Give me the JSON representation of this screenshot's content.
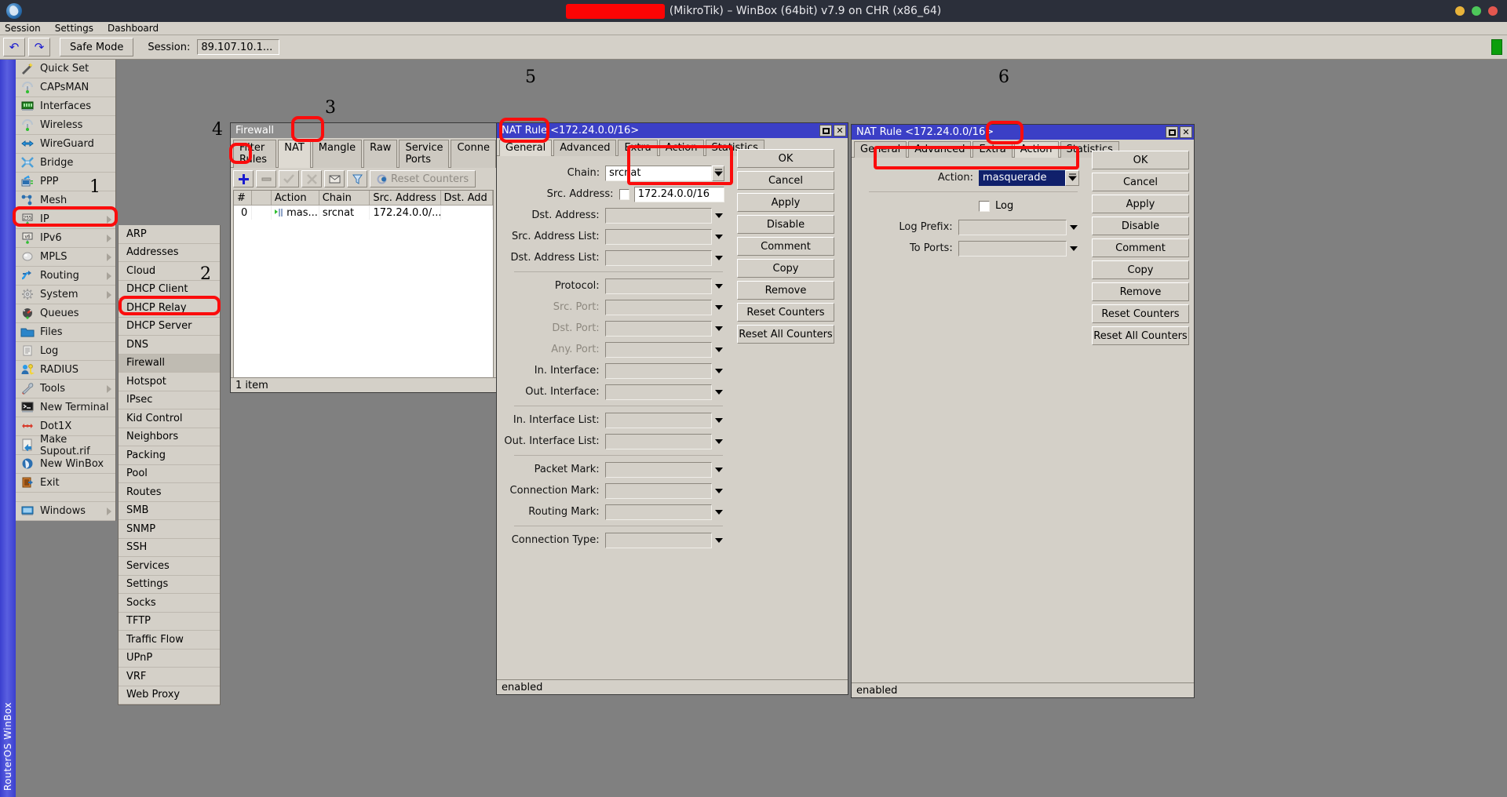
{
  "os": {
    "title_redacted": true,
    "title_suffix": "(MikroTik) – WinBox (64bit) v7.9 on CHR (x86_64)",
    "window_controls": [
      "minimize",
      "maximize",
      "close"
    ]
  },
  "menubar": {
    "items": [
      "Session",
      "Settings",
      "Dashboard"
    ]
  },
  "toolbar": {
    "undo_icon": "undo-icon",
    "redo_icon": "redo-icon",
    "safe_mode_label": "Safe Mode",
    "session_label": "Session:",
    "session_value": "89.107.10.1..."
  },
  "left_strip": {
    "label": "RouterOS WinBox"
  },
  "mainmenu": {
    "items": [
      {
        "label": "Quick Set",
        "icon": "wand-icon",
        "arrow": false
      },
      {
        "label": "CAPsMAN",
        "icon": "antenna-icon",
        "arrow": false
      },
      {
        "label": "Interfaces",
        "icon": "nic-card-icon",
        "arrow": false
      },
      {
        "label": "Wireless",
        "icon": "antenna-icon",
        "arrow": false
      },
      {
        "label": "WireGuard",
        "icon": "arrows-icon",
        "arrow": false
      },
      {
        "label": "Bridge",
        "icon": "bridge-icon",
        "arrow": false
      },
      {
        "label": "PPP",
        "icon": "ppp-icon",
        "arrow": false
      },
      {
        "label": "Mesh",
        "icon": "mesh-icon",
        "arrow": false
      },
      {
        "label": "IP",
        "icon": "ip-255-icon",
        "arrow": true
      },
      {
        "label": "IPv6",
        "icon": "ipv6-icon",
        "arrow": true
      },
      {
        "label": "MPLS",
        "icon": "mpls-icon",
        "arrow": true
      },
      {
        "label": "Routing",
        "icon": "routing-icon",
        "arrow": true
      },
      {
        "label": "System",
        "icon": "gear-icon",
        "arrow": true
      },
      {
        "label": "Queues",
        "icon": "gauge-icon",
        "arrow": false
      },
      {
        "label": "Files",
        "icon": "folder-icon",
        "arrow": false
      },
      {
        "label": "Log",
        "icon": "log-icon",
        "arrow": false
      },
      {
        "label": "RADIUS",
        "icon": "radius-user-key-icon",
        "arrow": false
      },
      {
        "label": "Tools",
        "icon": "tools-icon",
        "arrow": true
      },
      {
        "label": "New Terminal",
        "icon": "terminal-icon",
        "arrow": false
      },
      {
        "label": "Dot1X",
        "icon": "dot1x-icon",
        "arrow": false
      },
      {
        "label": "Make Supout.rif",
        "icon": "supout-icon",
        "arrow": false
      },
      {
        "label": "New WinBox",
        "icon": "winbox-icon",
        "arrow": false
      },
      {
        "label": "Exit",
        "icon": "exit-icon",
        "arrow": false
      }
    ],
    "after_separator": [
      {
        "label": "Windows",
        "icon": "monitor-icon",
        "arrow": true
      }
    ]
  },
  "submenu": {
    "parent": "IP",
    "selected": "Firewall",
    "items": [
      "ARP",
      "Addresses",
      "Cloud",
      "DHCP Client",
      "DHCP Relay",
      "DHCP Server",
      "DNS",
      "Firewall",
      "Hotspot",
      "IPsec",
      "Kid Control",
      "Neighbors",
      "Packing",
      "Pool",
      "Routes",
      "SMB",
      "SNMP",
      "SSH",
      "Services",
      "Settings",
      "Socks",
      "TFTP",
      "Traffic Flow",
      "UPnP",
      "VRF",
      "Web Proxy"
    ]
  },
  "firewall_window": {
    "title": "Firewall",
    "tabs": [
      "Filter Rules",
      "NAT",
      "Mangle",
      "Raw",
      "Service Ports",
      "Conne"
    ],
    "active_tab": "NAT",
    "toolbar": {
      "add_icon": "plus-icon",
      "remove_icon": "minus-icon",
      "enable_icon": "check-icon",
      "disable_icon": "cross-icon",
      "comment_icon": "comment-icon",
      "filter_icon": "funnel-icon",
      "reset_counters_label": "Reset Counters",
      "reset_icon": "reset-counters-icon"
    },
    "columns": [
      "#",
      "",
      "Action",
      "Chain",
      "Src. Address",
      "Dst. Add"
    ],
    "rows": [
      {
        "num": "0",
        "flag": "",
        "action": "mas...",
        "chain": "srcnat",
        "src_address": "172.24.0.0/...",
        "dst_address": ""
      }
    ],
    "status": "1 item"
  },
  "nat_rule_general": {
    "title": "NAT Rule <172.24.0.0/16>",
    "tabs": [
      "General",
      "Advanced",
      "Extra",
      "Action",
      "Statistics"
    ],
    "active_tab": "General",
    "fields": [
      {
        "label": "Chain:",
        "value": "srcnat",
        "white": true,
        "dropdown_button": true,
        "disabled": false,
        "checkbox": false
      },
      {
        "label": "Src. Address:",
        "value": "172.24.0.0/16",
        "white": true,
        "dropdown_button": false,
        "disabled": false,
        "checkbox": true
      },
      {
        "label": "Dst. Address:",
        "value": "",
        "white": false,
        "dropdown_button": false,
        "disabled": false,
        "checkbox": false
      },
      {
        "label": "Src. Address List:",
        "value": "",
        "white": false,
        "dropdown_button": false,
        "disabled": false,
        "checkbox": false
      },
      {
        "label": "Dst. Address List:",
        "value": "",
        "white": false,
        "dropdown_button": false,
        "disabled": false,
        "checkbox": false
      },
      {
        "label": "Protocol:",
        "value": "",
        "white": false,
        "dropdown_button": false,
        "disabled": false,
        "checkbox": false,
        "gap_before": true
      },
      {
        "label": "Src. Port:",
        "value": "",
        "white": false,
        "dropdown_button": false,
        "disabled": true,
        "checkbox": false
      },
      {
        "label": "Dst. Port:",
        "value": "",
        "white": false,
        "dropdown_button": false,
        "disabled": true,
        "checkbox": false
      },
      {
        "label": "Any. Port:",
        "value": "",
        "white": false,
        "dropdown_button": false,
        "disabled": true,
        "checkbox": false
      },
      {
        "label": "In. Interface:",
        "value": "",
        "white": false,
        "dropdown_button": false,
        "disabled": false,
        "checkbox": false
      },
      {
        "label": "Out. Interface:",
        "value": "",
        "white": false,
        "dropdown_button": false,
        "disabled": false,
        "checkbox": false
      },
      {
        "label": "In. Interface List:",
        "value": "",
        "white": false,
        "dropdown_button": false,
        "disabled": false,
        "checkbox": false,
        "gap_before": true
      },
      {
        "label": "Out. Interface List:",
        "value": "",
        "white": false,
        "dropdown_button": false,
        "disabled": false,
        "checkbox": false
      },
      {
        "label": "Packet Mark:",
        "value": "",
        "white": false,
        "dropdown_button": false,
        "disabled": false,
        "checkbox": false,
        "gap_before": true
      },
      {
        "label": "Connection Mark:",
        "value": "",
        "white": false,
        "dropdown_button": false,
        "disabled": false,
        "checkbox": false
      },
      {
        "label": "Routing Mark:",
        "value": "",
        "white": false,
        "dropdown_button": false,
        "disabled": false,
        "checkbox": false
      },
      {
        "label": "Connection Type:",
        "value": "",
        "white": false,
        "dropdown_button": false,
        "disabled": false,
        "checkbox": false,
        "gap_before": true
      }
    ],
    "buttons": [
      "OK",
      "Cancel",
      "Apply",
      "Disable",
      "Comment",
      "Copy",
      "Remove",
      "Reset Counters",
      "Reset All Counters"
    ],
    "status": "enabled"
  },
  "nat_rule_action": {
    "title": "NAT Rule <172.24.0.0/16>",
    "tabs": [
      "General",
      "Advanced",
      "Extra",
      "Action",
      "Statistics"
    ],
    "active_tab": "Action",
    "action_label": "Action:",
    "action_value": "masquerade",
    "log_label": "Log",
    "log_checked": false,
    "log_prefix_label": "Log Prefix:",
    "log_prefix_value": "",
    "to_ports_label": "To Ports:",
    "to_ports_value": "",
    "buttons": [
      "OK",
      "Cancel",
      "Apply",
      "Disable",
      "Comment",
      "Copy",
      "Remove",
      "Reset Counters",
      "Reset All Counters"
    ],
    "status": "enabled"
  },
  "annotations": [
    {
      "id": "1",
      "target": "mainmenu-item-ip"
    },
    {
      "id": "2",
      "target": "submenu-item-firewall"
    },
    {
      "id": "3",
      "target": "firewall-tab-nat"
    },
    {
      "id": "4",
      "target": "firewall-add-button"
    },
    {
      "id": "5",
      "target": "nat-rule-general-dialog"
    },
    {
      "id": "6",
      "target": "nat-rule-action-dialog"
    }
  ],
  "colors": {
    "accent": "#3b3fc6",
    "highlight": "#fb0c0c",
    "chrome": "#d4d0c8",
    "desktop": "#808080",
    "titlebar": "#2b2f3a",
    "selection": "#10206b"
  }
}
